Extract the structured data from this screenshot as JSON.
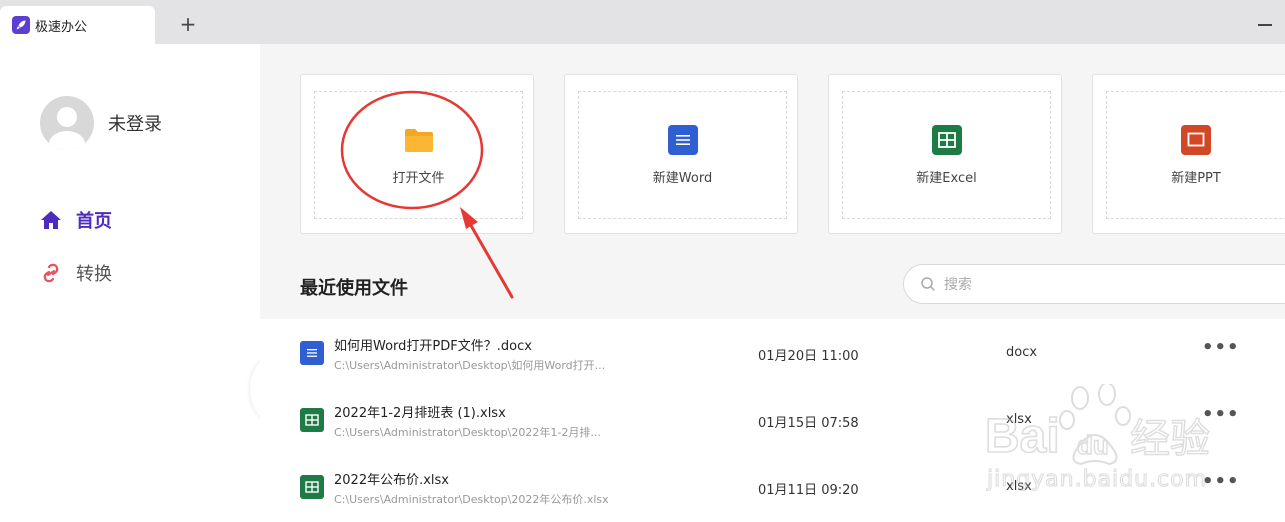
{
  "titlebar": {
    "tab_title": "极速办公",
    "new_tab_label": "+",
    "app_icon": "rocket-icon"
  },
  "sidebar": {
    "user_name": "未登录",
    "nav": [
      {
        "label": "首页",
        "icon": "home-icon",
        "active": true
      },
      {
        "label": "转换",
        "icon": "link-icon",
        "active": false
      }
    ]
  },
  "actions": [
    {
      "label": "打开文件",
      "icon": "folder-icon",
      "color": "#f5a623"
    },
    {
      "label": "新建Word",
      "icon": "word-icon",
      "color": "#2f5fd0"
    },
    {
      "label": "新建Excel",
      "icon": "excel-icon",
      "color": "#1e7b45"
    },
    {
      "label": "新建PPT",
      "icon": "ppt-icon",
      "color": "#d24726"
    }
  ],
  "recent": {
    "title": "最近使用文件",
    "search_placeholder": "搜索",
    "files": [
      {
        "name": "如何用Word打开PDF文件？.docx",
        "path": "C:\\Users\\Administrator\\Desktop\\如何用Word打开...",
        "time": "01月20日 11:00",
        "ext": "docx",
        "type": "word"
      },
      {
        "name": "2022年1-2月排班表 (1).xlsx",
        "path": "C:\\Users\\Administrator\\Desktop\\2022年1-2月排...",
        "time": "01月15日 07:58",
        "ext": "xlsx",
        "type": "excel"
      },
      {
        "name": "2022年公布价.xlsx",
        "path": "C:\\Users\\Administrator\\Desktop\\2022年公布价.xlsx",
        "time": "01月11日 09:20",
        "ext": "xlsx",
        "type": "excel"
      }
    ],
    "more_label": "•••"
  },
  "watermark": {
    "brand": "Bai",
    "brand2": "du",
    "product": "经验",
    "url": "jingyan.baidu.com"
  },
  "colors": {
    "accent": "#4c2bbd",
    "annotation": "#e53935"
  }
}
